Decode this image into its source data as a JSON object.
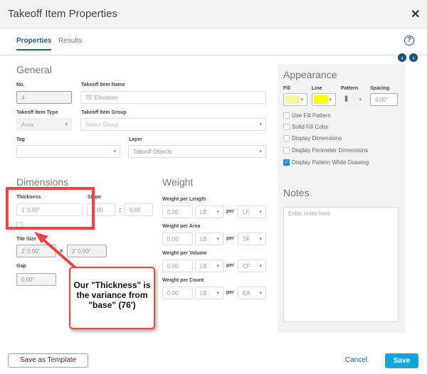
{
  "dialog": {
    "title": "Takeoff Item Properties",
    "close_icon": "close-icon"
  },
  "tabs": [
    {
      "label": "Properties",
      "active": true
    },
    {
      "label": "Results",
      "active": false
    }
  ],
  "general": {
    "heading": "General",
    "no_label": "No.",
    "no_value": "4",
    "name_label": "Takeoff Item Name",
    "name_value": "75' Elevation",
    "type_label": "Takeoff Item Type",
    "type_value": "Area",
    "group_label": "Takeoff Item Group",
    "group_placeholder": "Select Group",
    "tag_label": "Tag",
    "tag_value": "",
    "layer_label": "Layer",
    "layer_value": "Takeoff Objects"
  },
  "dimensions": {
    "heading": "Dimensions",
    "thickness_label": "Thickness",
    "thickness_value": "1' 0.00\"",
    "slope_label": "Slope",
    "slope_value1": "0.00",
    "slope_sep": ":",
    "slope_value2": "0.00",
    "tile_label": "Tile Size",
    "tile_w": "2' 0.00\"",
    "tile_x": "x",
    "tile_h": "2' 0.00\"",
    "gap_label": "Gap",
    "gap_value": "0.00\""
  },
  "weight": {
    "heading": "Weight",
    "per": "per",
    "rows": [
      {
        "label": "Weight per Length",
        "value": "0.00",
        "unit": "LB",
        "per_unit": "LF"
      },
      {
        "label": "Weight per Area",
        "value": "0.00",
        "unit": "LB",
        "per_unit": "SF"
      },
      {
        "label": "Weight per Volume",
        "value": "0.00",
        "unit": "LB",
        "per_unit": "CF"
      },
      {
        "label": "Weight per Count",
        "value": "0.00",
        "unit": "LB",
        "per_unit": "EA"
      }
    ]
  },
  "appearance": {
    "heading": "Appearance",
    "fill_label": "Fill",
    "line_label": "Line",
    "pattern_label": "Pattern",
    "spacing_label": "Spacing",
    "spacing_value": "6.00\"",
    "fill_color": "#f4f27a",
    "line_color": "#ffff00",
    "options": [
      {
        "label": "Use Fill Pattern",
        "checked": false
      },
      {
        "label": "Solid Fill Color",
        "checked": false
      },
      {
        "label": "Display Dimensions",
        "checked": false
      },
      {
        "label": "Display Perimeter Dimensions",
        "checked": false
      },
      {
        "label": "Display Pattern While Drawing",
        "checked": true
      }
    ]
  },
  "notes": {
    "heading": "Notes",
    "placeholder": "Enter notes here"
  },
  "annotation": {
    "text": "Our \"Thickness\" is the variance from \"base\" (76')",
    "color": "#ef4444"
  },
  "footer": {
    "template_label": "Save as Template",
    "cancel_label": "Cancel",
    "save_label": "Save"
  },
  "colors": {
    "accent": "#1e5b86",
    "save_button": "#0ea5e0"
  }
}
